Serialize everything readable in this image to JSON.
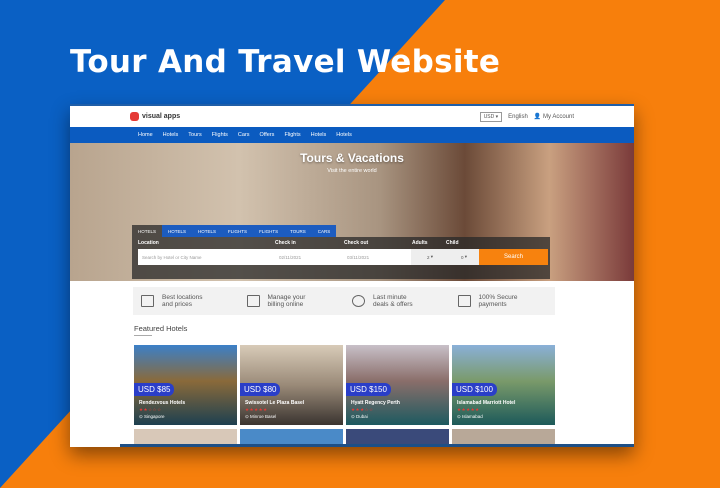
{
  "headline": "Tour And Travel Website",
  "site": {
    "logo": "visual apps",
    "currency": "USD",
    "language": "English",
    "account": "My Account"
  },
  "nav": [
    "Home",
    "Hotels",
    "Tours",
    "Flights",
    "Cars",
    "Offers",
    "Flights",
    "Hotels",
    "Hotels"
  ],
  "hero": {
    "title": "Tours & Vacations",
    "subtitle": "Visit the entire world"
  },
  "tabs": [
    "HOTELS",
    "HOTELS",
    "HOTELS",
    "FLIGHTS",
    "FLIGHTS",
    "TOURS",
    "CARS"
  ],
  "search": {
    "location_label": "Location",
    "checkin_label": "Check in",
    "checkout_label": "Check out",
    "adults_label": "Adults",
    "child_label": "Child",
    "placeholder": "Search by Hotel or City Name",
    "checkin": "02/11/2021",
    "checkout": "03/11/2021",
    "adults": "2",
    "child": "0",
    "button": "Search"
  },
  "features": [
    {
      "l1": "Best locations",
      "l2": "and prices"
    },
    {
      "l1": "Manage your",
      "l2": "billing online"
    },
    {
      "l1": "Last minute",
      "l2": "deals & offers"
    },
    {
      "l1": "100% Secure",
      "l2": "payments"
    }
  ],
  "featured_title": "Featured Hotels",
  "hotels": [
    {
      "price": "USD $85",
      "name": "Rendezvous Hotels",
      "stars": "★★☆☆☆",
      "location": "Singapore"
    },
    {
      "price": "USD $80",
      "name": "Swissotel Le Plaza Basel",
      "stars": "★★★★★",
      "location": "Minroe Basel"
    },
    {
      "price": "USD $150",
      "name": "Hyatt Regency Perth",
      "stars": "★★★☆☆",
      "location": "Dubai"
    },
    {
      "price": "USD $100",
      "name": "Islamabad Marriott Hotel",
      "stars": "★★★★★",
      "location": "Islamabad"
    }
  ]
}
